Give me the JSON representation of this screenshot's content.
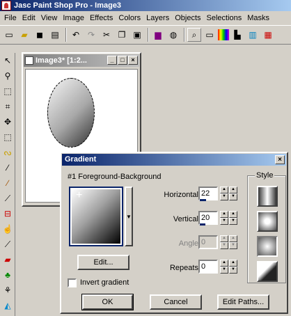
{
  "window": {
    "title": "Jasc Paint Shop Pro - Image3"
  },
  "menu": [
    "File",
    "Edit",
    "View",
    "Image",
    "Effects",
    "Colors",
    "Layers",
    "Objects",
    "Selections",
    "Masks"
  ],
  "toolbar": {
    "icons": [
      "new-icon",
      "open-icon",
      "save-icon",
      "print-icon",
      "undo-icon",
      "redo-icon",
      "cut-icon",
      "copy-icon",
      "paste-icon",
      "full-screen-icon",
      "browse-icon",
      "zoom-icon",
      "overview-icon",
      "color-palette-icon",
      "histogram-icon",
      "layers-icon",
      "tool-options-icon"
    ]
  },
  "toolbox": {
    "icons": [
      "arrow-icon",
      "zoom-icon",
      "deformation-icon",
      "crop-icon",
      "mover-icon",
      "selection-icon",
      "freehand-icon",
      "eyedropper-icon",
      "paintbrush-icon",
      "clone-brush-icon",
      "color-replacer-icon",
      "retouch-icon",
      "scratch-remover-icon",
      "eraser-icon",
      "picture-tube-icon",
      "airbrush-icon",
      "flood-fill-icon"
    ]
  },
  "document": {
    "title": "Image3* [1:2..."
  },
  "dialog": {
    "title": "Gradient",
    "gradient_name": "#1 Foreground-Background",
    "fields": {
      "horizontal": {
        "label": "Horizontal:",
        "value": "22",
        "level": 0.22
      },
      "vertical": {
        "label": "Vertical:",
        "value": "20",
        "level": 0.2
      },
      "angle": {
        "label": "Angle:",
        "value": "0",
        "disabled": true
      },
      "repeats": {
        "label": "Repeats:",
        "value": "0"
      }
    },
    "edit_button": "Edit...",
    "invert_label": "Invert gradient",
    "invert_checked": false,
    "style_label": "Style",
    "style_options": [
      "linear-gradient-icon",
      "rectangular-gradient-icon",
      "radial-gradient-icon",
      "sunburst-gradient-icon"
    ],
    "selected_style": 2,
    "buttons": {
      "ok": "OK",
      "cancel": "Cancel",
      "edit_paths": "Edit Paths..."
    }
  }
}
